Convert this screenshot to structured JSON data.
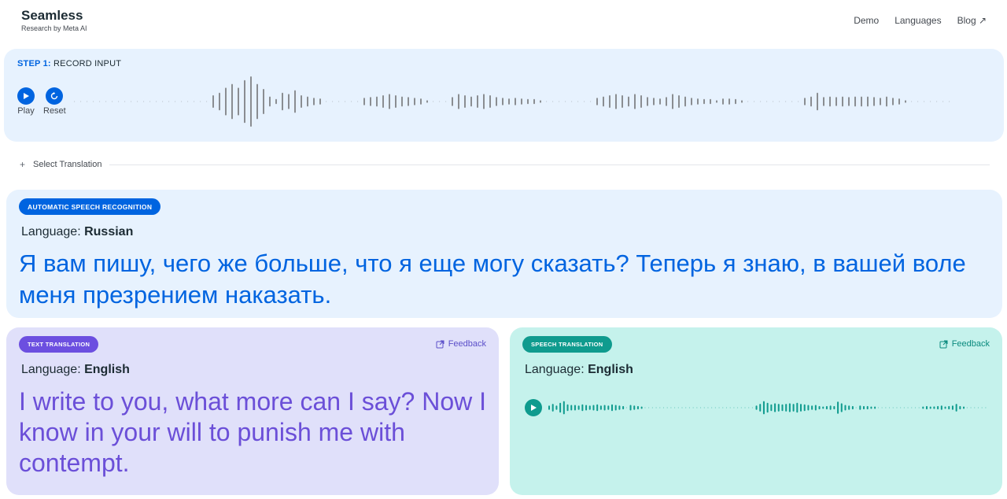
{
  "header": {
    "brand": "Seamless",
    "subtitle": "Research by Meta AI",
    "nav": {
      "demo": "Demo",
      "languages": "Languages",
      "blog": "Blog ↗"
    }
  },
  "record": {
    "step_number": "STEP 1:",
    "step_title": " RECORD INPUT",
    "play_label": "Play",
    "reset_label": "Reset",
    "icons": {
      "play": "play-icon",
      "reset": "reset-icon"
    },
    "waveform_amplitudes": [
      0,
      0,
      0,
      0,
      0,
      0,
      0,
      0,
      0,
      0,
      0,
      0,
      0,
      0,
      0,
      0,
      0,
      0,
      0,
      0,
      0,
      0,
      0.25,
      0.35,
      0.55,
      0.7,
      0.55,
      0.85,
      1,
      0.7,
      0.5,
      0.2,
      0.1,
      0.35,
      0.3,
      0.45,
      0.25,
      0.2,
      0.15,
      0.12,
      0,
      0,
      0,
      0,
      0,
      0,
      0.15,
      0.18,
      0.2,
      0.25,
      0.3,
      0.25,
      0.2,
      0.18,
      0.15,
      0.12,
      0.05,
      0,
      0,
      0,
      0.18,
      0.3,
      0.25,
      0.2,
      0.25,
      0.3,
      0.25,
      0.18,
      0.15,
      0.12,
      0.15,
      0.12,
      0.1,
      0.1,
      0.05,
      0,
      0,
      0,
      0,
      0,
      0,
      0,
      0,
      0.15,
      0.2,
      0.25,
      0.3,
      0.25,
      0.2,
      0.3,
      0.25,
      0.18,
      0.15,
      0.12,
      0.18,
      0.3,
      0.25,
      0.2,
      0.15,
      0.12,
      0.1,
      0.1,
      0.05,
      0.12,
      0.12,
      0.1,
      0.05,
      0,
      0,
      0,
      0,
      0,
      0,
      0,
      0,
      0,
      0.15,
      0.2,
      0.35,
      0.18,
      0.2,
      0.18,
      0.2,
      0.18,
      0.2,
      0.2,
      0.2,
      0.18,
      0.15,
      0.2,
      0.15,
      0.12,
      0.05,
      0,
      0,
      0,
      0,
      0,
      0,
      0
    ]
  },
  "select_translation": {
    "label": "Select Translation"
  },
  "asr": {
    "badge": "AUTOMATIC SPEECH RECOGNITION",
    "language_label": "Language:",
    "language": "Russian",
    "text": "Я вам пишу, чего же больше, что я еще могу сказать? Теперь я знаю, в вашей воле меня презрением наказать."
  },
  "text_translation": {
    "badge": "TEXT TRANSLATION",
    "feedback": "Feedback",
    "language_label": "Language:",
    "language": "English",
    "text": "I write to you, what more can I say? Now I know in your will to punish me with contempt."
  },
  "speech_translation": {
    "badge": "SPEECH TRANSLATION",
    "feedback": "Feedback",
    "language_label": "Language:",
    "language": "English",
    "waveform_amplitudes": [
      0.2,
      0.35,
      0.2,
      0.45,
      0.6,
      0.3,
      0.25,
      0.25,
      0.2,
      0.3,
      0.25,
      0.2,
      0.25,
      0.3,
      0.2,
      0.25,
      0.2,
      0.3,
      0.25,
      0.2,
      0.15,
      0,
      0.25,
      0.2,
      0.15,
      0.1,
      0,
      0,
      0,
      0,
      0,
      0,
      0,
      0,
      0,
      0,
      0,
      0,
      0,
      0,
      0,
      0,
      0,
      0,
      0,
      0,
      0,
      0,
      0,
      0,
      0,
      0,
      0,
      0,
      0,
      0,
      0.2,
      0.35,
      0.6,
      0.45,
      0.3,
      0.4,
      0.35,
      0.3,
      0.35,
      0.4,
      0.35,
      0.45,
      0.35,
      0.3,
      0.25,
      0.2,
      0.25,
      0.15,
      0.1,
      0.15,
      0.2,
      0.15,
      0.55,
      0.4,
      0.25,
      0.2,
      0.15,
      0,
      0.2,
      0.15,
      0.15,
      0.1,
      0.1,
      0,
      0,
      0,
      0,
      0,
      0,
      0,
      0,
      0,
      0,
      0,
      0,
      0.1,
      0.15,
      0.1,
      0.12,
      0.15,
      0.2,
      0.1,
      0.15,
      0.2,
      0.35,
      0.15,
      0.1,
      0,
      0,
      0,
      0,
      0,
      0
    ]
  },
  "colors": {
    "brand_blue": "#0064e0",
    "panel_blue": "#e7f2fe",
    "purple_panel": "#e0e0fa",
    "purple_text": "#6b4fd8",
    "teal_panel": "#c5f2ec",
    "teal_accent": "#0f9b8e",
    "waveform_gray": "#8a8d91"
  }
}
